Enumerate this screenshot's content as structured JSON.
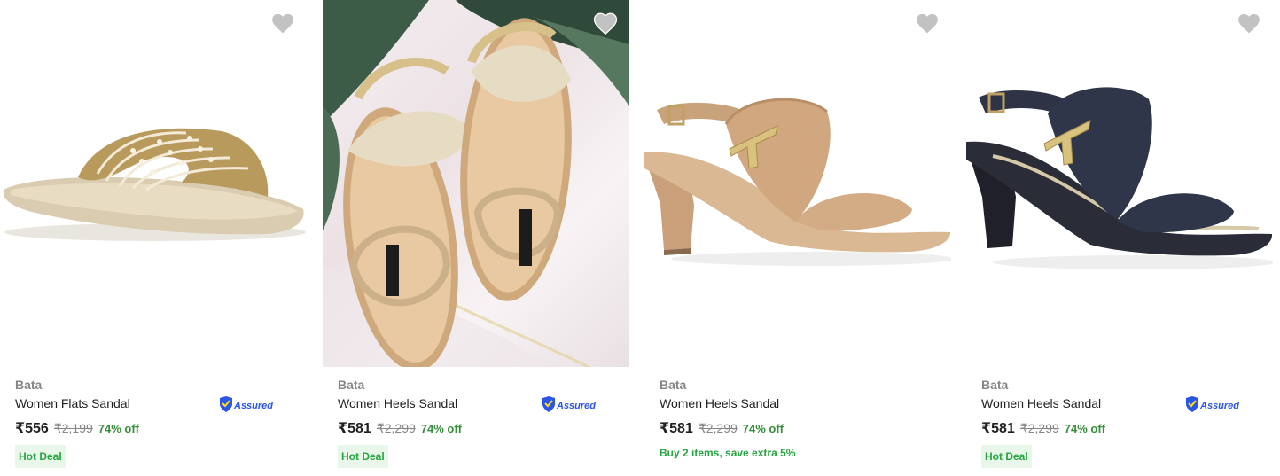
{
  "products": [
    {
      "brand": "Bata",
      "title": "Women Flats Sandal",
      "price": "₹556",
      "mrp": "₹2,199",
      "discount": "74% off",
      "badge": "Hot Deal",
      "assured_label": "Assured",
      "icon": "heart-icon"
    },
    {
      "brand": "Bata",
      "title": "Women Heels Sandal",
      "price": "₹581",
      "mrp": "₹2,299",
      "discount": "74% off",
      "badge": "Hot Deal",
      "assured_label": "Assured",
      "icon": "heart-icon"
    },
    {
      "brand": "Bata",
      "title": "Women Heels Sandal",
      "price": "₹581",
      "mrp": "₹2,299",
      "discount": "74% off",
      "offer": "Buy 2 items, save extra 5%",
      "icon": "heart-icon"
    },
    {
      "brand": "Bata",
      "title": "Women Heels Sandal",
      "price": "₹581",
      "mrp": "₹2,299",
      "discount": "74% off",
      "badge": "Hot Deal",
      "assured_label": "Assured",
      "icon": "heart-icon"
    }
  ],
  "colors": {
    "brand_text": "#878787",
    "discount_green": "#388e3c",
    "deal_bg": "#e8f7ea",
    "deal_text": "#26a541",
    "wishlist_grey": "#c2c2c2",
    "assured_blue": "#2a55e5"
  }
}
